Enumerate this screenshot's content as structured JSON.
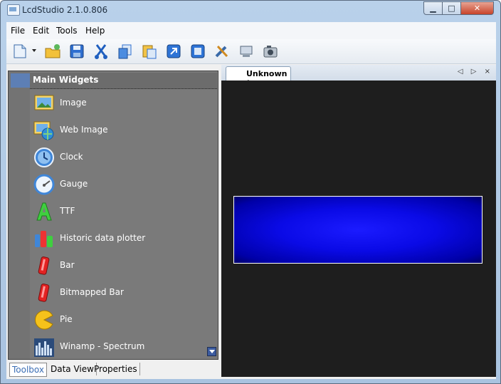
{
  "window": {
    "title": "LcdStudio 2.1.0.806"
  },
  "menu": [
    "File",
    "Edit",
    "Tools",
    "Help"
  ],
  "toolbar": [
    {
      "icon": "new-document-icon"
    },
    {
      "icon": "open-folder-icon"
    },
    {
      "icon": "save-icon"
    },
    {
      "icon": "cut-icon"
    },
    {
      "icon": "copy-icon"
    },
    {
      "icon": "paste-icon"
    },
    {
      "icon": "import-icon"
    },
    {
      "icon": "export-icon"
    },
    {
      "icon": "tools-icon"
    },
    {
      "icon": "display-icon"
    },
    {
      "icon": "camera-icon"
    }
  ],
  "toolbox": {
    "header": "Main Widgets",
    "items": [
      {
        "label": "Image",
        "icon": "image-icon"
      },
      {
        "label": "Web Image",
        "icon": "web-image-icon"
      },
      {
        "label": "Clock",
        "icon": "clock-icon"
      },
      {
        "label": "Gauge",
        "icon": "gauge-icon"
      },
      {
        "label": "TTF",
        "icon": "ttf-font-icon"
      },
      {
        "label": "Historic data plotter",
        "icon": "plotter-icon"
      },
      {
        "label": "Bar",
        "icon": "bar-icon"
      },
      {
        "label": "Bitmapped Bar",
        "icon": "bitmapped-bar-icon"
      },
      {
        "label": "Pie",
        "icon": "pie-icon"
      },
      {
        "label": "Winamp - Spectrum",
        "icon": "spectrum-icon"
      }
    ]
  },
  "bottom_tabs": [
    "Toolbox",
    "Data View",
    "Properties"
  ],
  "document": {
    "tab": "Unknown *",
    "nav": "◁ ▷ ×"
  },
  "colors": {
    "lcd": "#0a0ae6",
    "canvas": "#1e1e1e",
    "toolbox": "#7a7a7a"
  }
}
